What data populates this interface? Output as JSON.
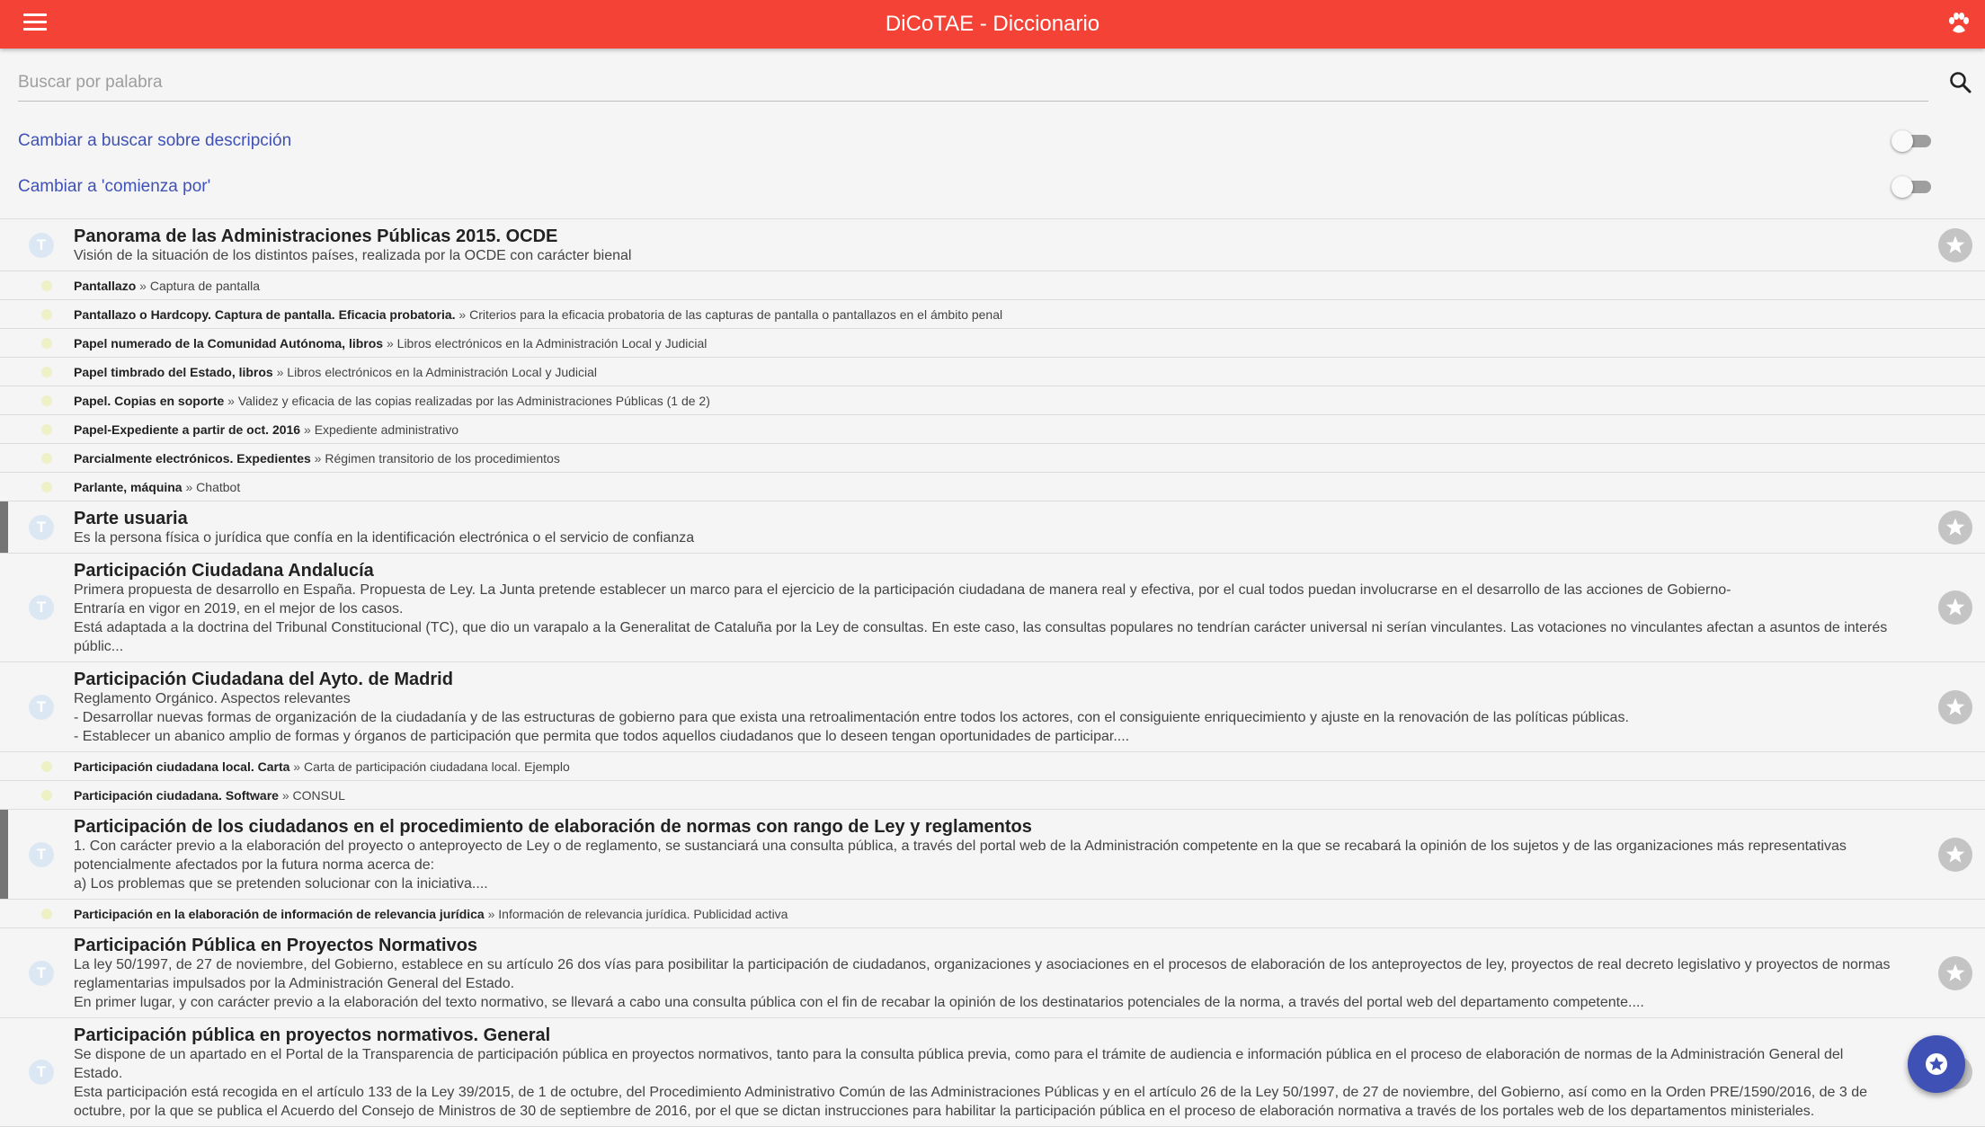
{
  "app": {
    "title": "DiCoTAE - Diccionario"
  },
  "search": {
    "placeholder": "Buscar por palabra",
    "value": ""
  },
  "options": [
    {
      "label": "Cambiar a buscar sobre descripción",
      "on": false
    },
    {
      "label": "Cambiar a 'comienza por'",
      "on": false
    }
  ],
  "colors": {
    "toolbar": "#f44336",
    "accent": "#3f51b5",
    "link": "#3f51b5"
  },
  "icons": {
    "menu": "menu-icon",
    "toolbar_right": "paw-icon",
    "search": "search-icon",
    "favorite": "star-icon",
    "fab": "star-circle-icon"
  },
  "entries": [
    {
      "kind": "term",
      "marked": false,
      "title": "Panorama de las Administraciones Públicas 2015. OCDE",
      "desc": "Visión de la situación de los distintos países, realizada por la OCDE con carácter bienal"
    },
    {
      "kind": "ref",
      "title": "Pantallazo",
      "target": "Captura de pantalla"
    },
    {
      "kind": "ref",
      "title": "Pantallazo o Hardcopy. Captura de pantalla. Eficacia probatoria.",
      "target": "Criterios para la eficacia probatoria de las capturas de pantalla o pantallazos en el ámbito penal"
    },
    {
      "kind": "ref",
      "title": "Papel numerado de la Comunidad Autónoma, libros",
      "target": "Libros electrónicos en la Administración Local y Judicial"
    },
    {
      "kind": "ref",
      "title": "Papel timbrado del Estado, libros",
      "target": "Libros electrónicos en la Administración Local y Judicial"
    },
    {
      "kind": "ref",
      "title": "Papel. Copias en soporte",
      "target": "Validez y eficacia de las copias realizadas por las Administraciones Públicas (1 de 2)"
    },
    {
      "kind": "ref",
      "title": "Papel-Expediente a partir de oct. 2016",
      "target": "Expediente administrativo"
    },
    {
      "kind": "ref",
      "title": "Parcialmente electrónicos. Expedientes",
      "target": "Régimen transitorio de los procedimientos"
    },
    {
      "kind": "ref",
      "title": "Parlante, máquina",
      "target": "Chatbot"
    },
    {
      "kind": "term",
      "marked": true,
      "title": "Parte usuaria",
      "desc": "Es la persona física o jurídica que confía en la identificación electrónica o el servicio de confianza"
    },
    {
      "kind": "term",
      "marked": false,
      "title": "Participación Ciudadana Andalucía",
      "desc": "Primera propuesta de desarrollo en España. Propuesta de Ley. La Junta pretende establecer un marco para el ejercicio de la participación ciudadana de manera real y efectiva, por el cual todos puedan involucrarse en el desarrollo de las acciones de Gobierno-\nEntraría en vigor en 2019, en el mejor de los casos.\nEstá adaptada a la doctrina del Tribunal Constitucional (TC), que dio un varapalo a la Generalitat de Cataluña por la Ley de consultas. En este caso, las consultas populares no tendrían carácter universal ni serían vinculantes. Las votaciones no vinculantes afectan a asuntos de interés públic..."
    },
    {
      "kind": "term",
      "marked": false,
      "title": "Participación Ciudadana del Ayto. de Madrid",
      "desc": "Reglamento Orgánico. Aspectos relevantes\n- Desarrollar nuevas formas de organización de la ciudadanía y de las estructuras de gobierno para que exista una retroalimentación entre todos los actores, con el consiguiente enriquecimiento y ajuste en la renovación de las políticas públicas.\n- Establecer un abanico amplio de formas y órganos de participación que permita que todos aquellos ciudadanos que lo deseen tengan oportunidades de participar...."
    },
    {
      "kind": "ref",
      "title": "Participación ciudadana local. Carta",
      "target": "Carta de participación ciudadana local. Ejemplo"
    },
    {
      "kind": "ref",
      "title": "Participación ciudadana. Software",
      "target": "CONSUL"
    },
    {
      "kind": "term",
      "marked": true,
      "title": "Participación de los ciudadanos en el procedimiento de elaboración de normas con rango de Ley y reglamentos",
      "desc": "1. Con carácter previo a la elaboración del proyecto o anteproyecto de Ley o de reglamento, se sustanciará una consulta pública, a través del portal web de la Administración competente en la que se recabará la opinión de los sujetos y de las organizaciones más representativas potencialmente afectados por la futura norma acerca de:\na) Los problemas que se pretenden solucionar con la iniciativa...."
    },
    {
      "kind": "ref",
      "title": "Participación en la elaboración de información de relevancia jurídica",
      "target": "Información de relevancia jurídica. Publicidad activa"
    },
    {
      "kind": "term",
      "marked": false,
      "title": "Participación Pública en Proyectos Normativos",
      "desc": "La ley 50/1997, de 27 de noviembre, del Gobierno, establece en su artículo 26 dos vías para posibilitar la participación de ciudadanos, organizaciones y asociaciones en el procesos de elaboración de los anteproyectos de ley, proyectos de real decreto legislativo y proyectos de normas reglamentarias impulsados por la Administración General del Estado.\nEn primer lugar, y con carácter previo a la elaboración del texto normativo, se llevará a cabo una consulta pública con el fin de recabar la opinión de los destinatarios potenciales de la norma, a través del portal web del departamento competente...."
    },
    {
      "kind": "term",
      "marked": false,
      "title": "Participación pública en proyectos normativos. General",
      "desc": "Se dispone de un apartado en el Portal de la Transparencia de participación pública en proyectos normativos, tanto para la consulta pública previa, como para el trámite de audiencia e información pública en el proceso de elaboración de normas de la Administración General del Estado.\nEsta participación está recogida en el artículo 133 de la Ley 39/2015, de 1 de octubre, del Procedimiento Administrativo Común de las Administraciones Públicas y en el artículo 26 de la Ley 50/1997, de 27 de noviembre, del Gobierno, así como en la Orden PRE/1590/2016, de 3 de octubre, por la que se publica el Acuerdo del Consejo de Ministros de 30 de septiembre de 2016, por el que se dictan instrucciones para habilitar la participación pública en el proceso de elaboración normativa a través de los portales web de los departamentos ministeriales."
    }
  ]
}
